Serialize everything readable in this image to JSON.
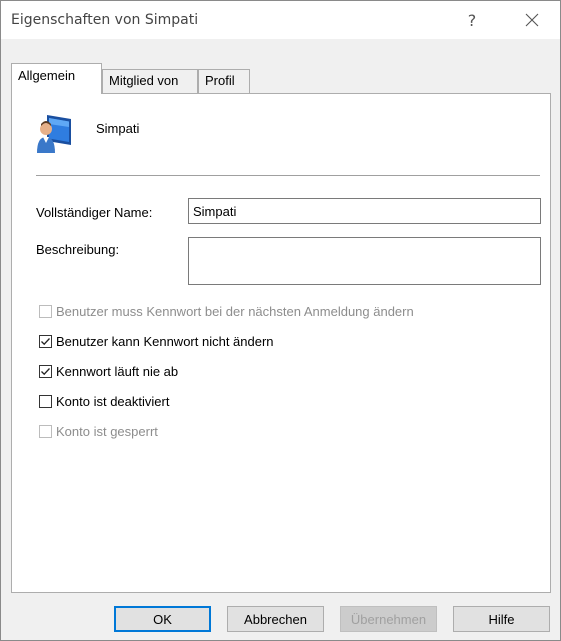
{
  "window": {
    "title": "Eigenschaften von Simpati",
    "help": "?"
  },
  "tabs": [
    {
      "label": "Allgemein",
      "active": true
    },
    {
      "label": "Mitglied von",
      "active": false
    },
    {
      "label": "Profil",
      "active": false
    }
  ],
  "user": {
    "name": "Simpati",
    "icon": "user-computer-icon"
  },
  "fields": {
    "full_name_label": "Vollständiger Name:",
    "full_name_value": "Simpati",
    "description_label": "Beschreibung:",
    "description_value": ""
  },
  "checkboxes": [
    {
      "label": "Benutzer muss Kennwort bei der nächsten Anmeldung ändern",
      "checked": false,
      "enabled": false
    },
    {
      "label": "Benutzer kann Kennwort nicht ändern",
      "checked": true,
      "enabled": true
    },
    {
      "label": "Kennwort läuft nie ab",
      "checked": true,
      "enabled": true
    },
    {
      "label": "Konto ist deaktiviert",
      "checked": false,
      "enabled": true
    },
    {
      "label": "Konto ist gesperrt",
      "checked": false,
      "enabled": false
    }
  ],
  "buttons": {
    "ok": "OK",
    "cancel": "Abbrechen",
    "apply": "Übernehmen",
    "help": "Hilfe"
  },
  "colors": {
    "accent": "#0078d7",
    "disabled_text": "#8d8d8d"
  }
}
